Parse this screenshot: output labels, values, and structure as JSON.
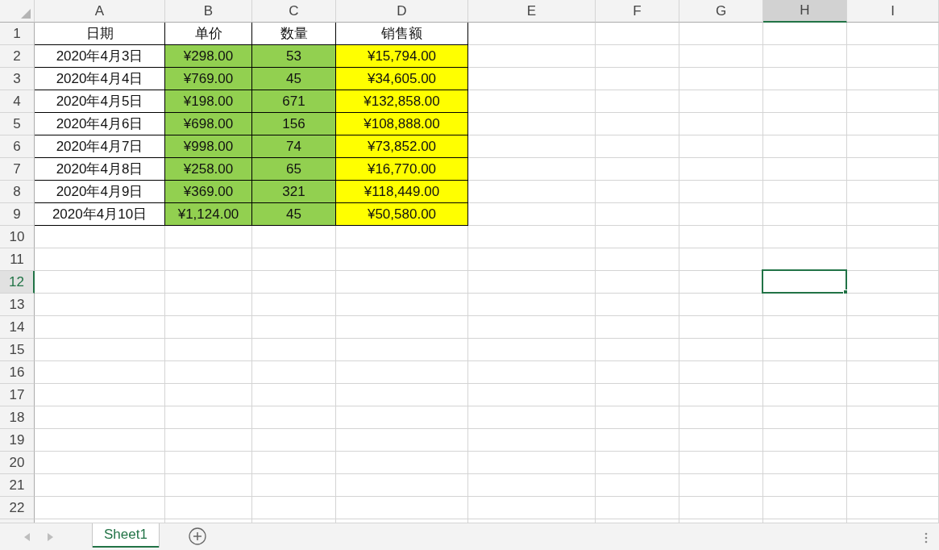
{
  "columns": [
    {
      "label": "A",
      "selected": false
    },
    {
      "label": "B",
      "selected": false
    },
    {
      "label": "C",
      "selected": false
    },
    {
      "label": "D",
      "selected": false
    },
    {
      "label": "E",
      "selected": false
    },
    {
      "label": "F",
      "selected": false
    },
    {
      "label": "G",
      "selected": false
    },
    {
      "label": "H",
      "selected": true
    },
    {
      "label": "I",
      "selected": false
    }
  ],
  "rows": [
    {
      "label": "1",
      "selected": false,
      "cells": [
        {
          "text": "日期",
          "bordered": true
        },
        {
          "text": "单价",
          "bordered": true
        },
        {
          "text": "数量",
          "bordered": true
        },
        {
          "text": "销售额",
          "bordered": true
        }
      ]
    },
    {
      "label": "2",
      "selected": false,
      "cells": [
        {
          "text": "2020年4月3日",
          "bordered": true
        },
        {
          "text": "¥298.00",
          "bordered": true,
          "color": "#92d050"
        },
        {
          "text": "53",
          "bordered": true,
          "color": "#92d050"
        },
        {
          "text": "¥15,794.00",
          "bordered": true,
          "color": "#ffff00"
        }
      ]
    },
    {
      "label": "3",
      "selected": false,
      "cells": [
        {
          "text": "2020年4月4日",
          "bordered": true
        },
        {
          "text": "¥769.00",
          "bordered": true,
          "color": "#92d050"
        },
        {
          "text": "45",
          "bordered": true,
          "color": "#92d050"
        },
        {
          "text": "¥34,605.00",
          "bordered": true,
          "color": "#ffff00"
        }
      ]
    },
    {
      "label": "4",
      "selected": false,
      "cells": [
        {
          "text": "2020年4月5日",
          "bordered": true
        },
        {
          "text": "¥198.00",
          "bordered": true,
          "color": "#92d050"
        },
        {
          "text": "671",
          "bordered": true,
          "color": "#92d050"
        },
        {
          "text": "¥132,858.00",
          "bordered": true,
          "color": "#ffff00"
        }
      ]
    },
    {
      "label": "5",
      "selected": false,
      "cells": [
        {
          "text": "2020年4月6日",
          "bordered": true
        },
        {
          "text": "¥698.00",
          "bordered": true,
          "color": "#92d050"
        },
        {
          "text": "156",
          "bordered": true,
          "color": "#92d050"
        },
        {
          "text": "¥108,888.00",
          "bordered": true,
          "color": "#ffff00"
        }
      ]
    },
    {
      "label": "6",
      "selected": false,
      "cells": [
        {
          "text": "2020年4月7日",
          "bordered": true
        },
        {
          "text": "¥998.00",
          "bordered": true,
          "color": "#92d050"
        },
        {
          "text": "74",
          "bordered": true,
          "color": "#92d050"
        },
        {
          "text": "¥73,852.00",
          "bordered": true,
          "color": "#ffff00"
        }
      ]
    },
    {
      "label": "7",
      "selected": false,
      "cells": [
        {
          "text": "2020年4月8日",
          "bordered": true
        },
        {
          "text": "¥258.00",
          "bordered": true,
          "color": "#92d050"
        },
        {
          "text": "65",
          "bordered": true,
          "color": "#92d050"
        },
        {
          "text": "¥16,770.00",
          "bordered": true,
          "color": "#ffff00"
        }
      ]
    },
    {
      "label": "8",
      "selected": false,
      "cells": [
        {
          "text": "2020年4月9日",
          "bordered": true
        },
        {
          "text": "¥369.00",
          "bordered": true,
          "color": "#92d050"
        },
        {
          "text": "321",
          "bordered": true,
          "color": "#92d050"
        },
        {
          "text": "¥118,449.00",
          "bordered": true,
          "color": "#ffff00"
        }
      ]
    },
    {
      "label": "9",
      "selected": false,
      "cells": [
        {
          "text": "2020年4月10日",
          "bordered": true
        },
        {
          "text": "¥1,124.00",
          "bordered": true,
          "color": "#92d050"
        },
        {
          "text": "45",
          "bordered": true,
          "color": "#92d050"
        },
        {
          "text": "¥50,580.00",
          "bordered": true,
          "color": "#ffff00"
        }
      ]
    },
    {
      "label": "10",
      "selected": false
    },
    {
      "label": "11",
      "selected": false
    },
    {
      "label": "12",
      "selected": true
    },
    {
      "label": "13",
      "selected": false
    },
    {
      "label": "14",
      "selected": false
    },
    {
      "label": "15",
      "selected": false
    },
    {
      "label": "16",
      "selected": false
    },
    {
      "label": "17",
      "selected": false
    },
    {
      "label": "18",
      "selected": false
    },
    {
      "label": "19",
      "selected": false
    },
    {
      "label": "20",
      "selected": false
    },
    {
      "label": "21",
      "selected": false
    },
    {
      "label": "22",
      "selected": false
    }
  ],
  "sheet_tabs": [
    {
      "label": "Sheet1",
      "selected": true
    }
  ]
}
